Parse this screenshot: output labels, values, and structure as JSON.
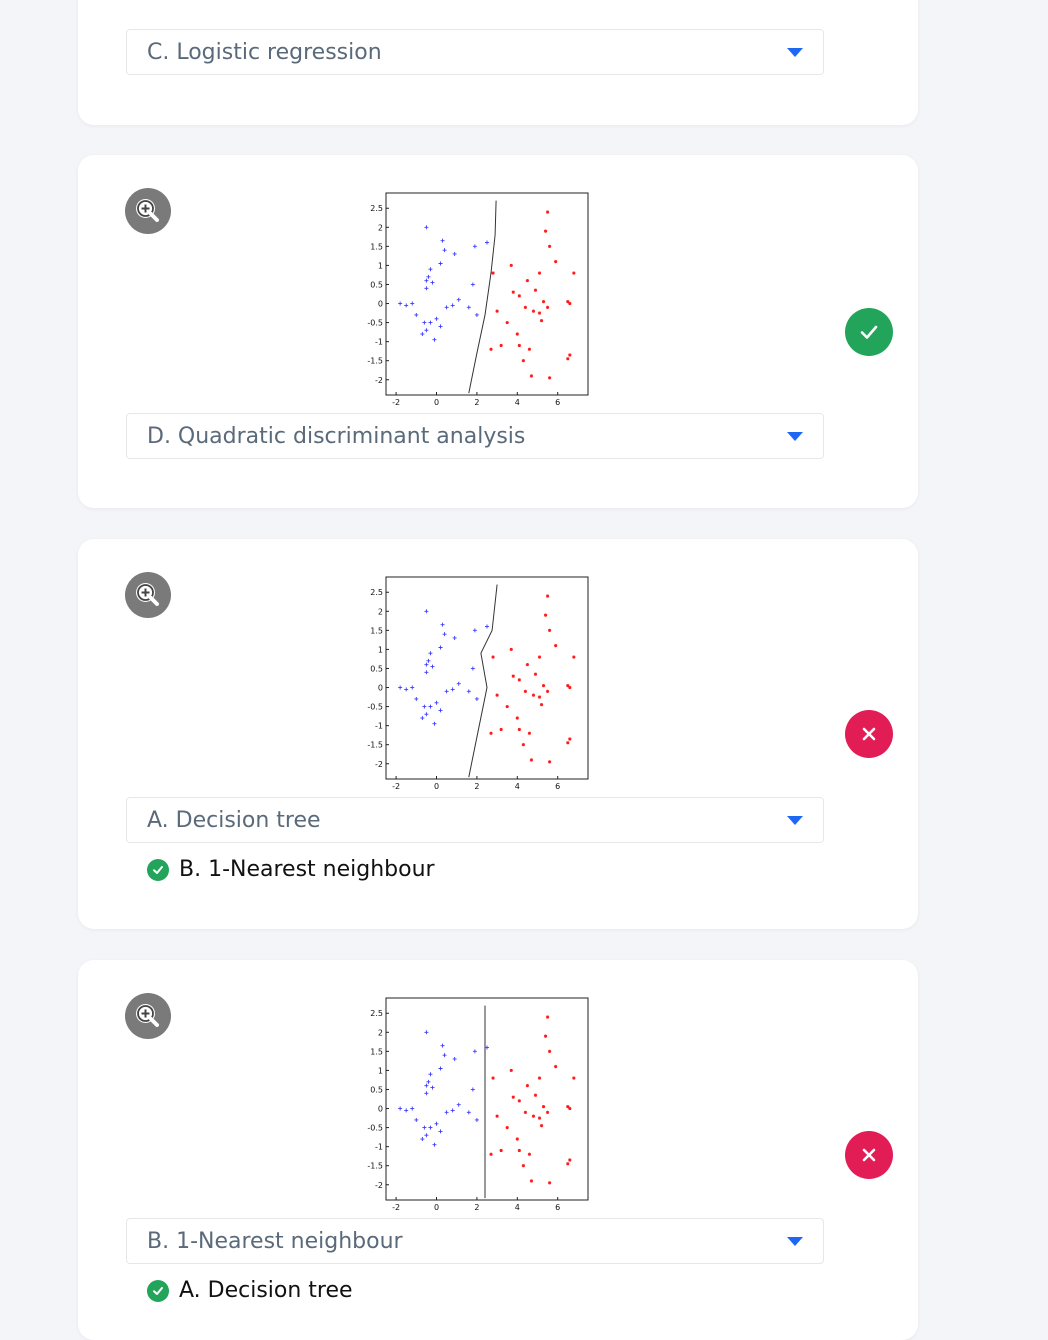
{
  "colors": {
    "class_a": "#3b3bff",
    "class_b": "#ff1a1a",
    "correct": "#22a55a",
    "wrong": "#e21d56",
    "caret": "#1e66f5"
  },
  "icons": {
    "zoom": "zoom-in-icon",
    "correct": "check-icon",
    "wrong": "close-icon",
    "dropdown": "caret-down-icon"
  },
  "axes": {
    "x_ticks": [
      "-2",
      "0",
      "2",
      "4",
      "6"
    ],
    "y_ticks": [
      "2.5",
      "2",
      "1.5",
      "1",
      "0.5",
      "0",
      "-0.5",
      "-1",
      "-1.5",
      "-2"
    ],
    "xlim": [
      -2.5,
      7.5
    ],
    "ylim": [
      -2.4,
      2.9
    ]
  },
  "questions": [
    {
      "selected": "C. Logistic regression",
      "plot_partial": true
    },
    {
      "selected": "D. Quadratic discriminant analysis",
      "status": "correct"
    },
    {
      "selected": "A. Decision tree",
      "status": "wrong",
      "correct_answer": "B. 1-Nearest neighbour"
    },
    {
      "selected": "B. 1-Nearest neighbour",
      "status": "wrong",
      "correct_answer": "A. Decision tree"
    }
  ],
  "chart_data": [
    {
      "type": "scatter",
      "boundary": "quadratic",
      "boundary_points": [
        [
          2.95,
          2.7
        ],
        [
          2.9,
          1.8
        ],
        [
          2.7,
          0.8
        ],
        [
          2.4,
          -0.3
        ],
        [
          2.0,
          -1.3
        ],
        [
          1.6,
          -2.35
        ]
      ]
    },
    {
      "type": "scatter",
      "boundary": "nearest-neighbour",
      "boundary_points": [
        [
          3.0,
          2.7
        ],
        [
          2.75,
          1.5
        ],
        [
          2.2,
          0.9
        ],
        [
          2.5,
          0.0
        ],
        [
          2.0,
          -1.3
        ],
        [
          1.6,
          -2.35
        ]
      ]
    },
    {
      "type": "scatter",
      "boundary": "decision-tree",
      "boundary_points": [
        [
          2.4,
          2.7
        ],
        [
          2.4,
          -2.35
        ]
      ]
    }
  ],
  "points": {
    "class_a": [
      [
        -0.5,
        2.0
      ],
      [
        0.3,
        1.65
      ],
      [
        0.4,
        1.4
      ],
      [
        0.9,
        1.3
      ],
      [
        0.2,
        1.05
      ],
      [
        1.9,
        1.5
      ],
      [
        2.5,
        1.6
      ],
      [
        -0.3,
        0.9
      ],
      [
        -0.4,
        0.7
      ],
      [
        -0.5,
        0.6
      ],
      [
        -0.5,
        0.4
      ],
      [
        1.8,
        0.5
      ],
      [
        -1.8,
        0.0
      ],
      [
        -1.5,
        -0.05
      ],
      [
        -1.2,
        0.0
      ],
      [
        -1.0,
        -0.3
      ],
      [
        -0.6,
        -0.5
      ],
      [
        -0.3,
        -0.5
      ],
      [
        -0.5,
        -0.7
      ],
      [
        -0.7,
        -0.8
      ],
      [
        -0.1,
        -0.95
      ],
      [
        0.0,
        -0.4
      ],
      [
        0.2,
        -0.6
      ],
      [
        0.5,
        -0.1
      ],
      [
        0.8,
        -0.05
      ],
      [
        1.1,
        0.1
      ],
      [
        1.6,
        -0.1
      ],
      [
        2.0,
        -0.3
      ],
      [
        -0.2,
        0.55
      ]
    ],
    "class_b": [
      [
        5.5,
        2.4
      ],
      [
        5.4,
        1.9
      ],
      [
        5.6,
        1.5
      ],
      [
        5.9,
        1.1
      ],
      [
        2.8,
        0.8
      ],
      [
        3.7,
        1.0
      ],
      [
        4.5,
        0.6
      ],
      [
        5.1,
        0.8
      ],
      [
        6.8,
        0.8
      ],
      [
        3.0,
        -0.2
      ],
      [
        3.5,
        -0.5
      ],
      [
        4.4,
        -0.1
      ],
      [
        4.8,
        -0.2
      ],
      [
        5.1,
        -0.25
      ],
      [
        5.3,
        0.05
      ],
      [
        5.2,
        -0.45
      ],
      [
        5.5,
        -0.1
      ],
      [
        4.1,
        0.2
      ],
      [
        4.9,
        0.35
      ],
      [
        4.0,
        -0.8
      ],
      [
        3.2,
        -1.1
      ],
      [
        4.3,
        -1.5
      ],
      [
        4.7,
        -1.9
      ],
      [
        5.6,
        -1.95
      ],
      [
        6.5,
        -1.45
      ],
      [
        6.6,
        -1.35
      ],
      [
        4.1,
        -1.1
      ],
      [
        2.7,
        -1.2
      ],
      [
        6.5,
        0.05
      ],
      [
        6.6,
        0.0
      ],
      [
        3.8,
        0.3
      ],
      [
        4.6,
        -1.2
      ]
    ]
  }
}
